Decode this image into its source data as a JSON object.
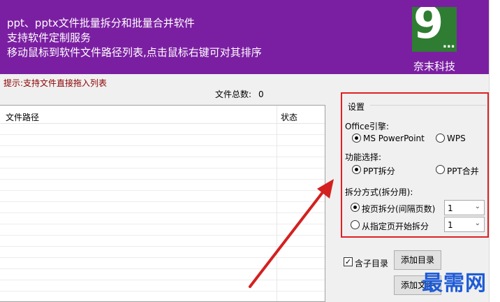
{
  "header": {
    "line1": "ppt、pptx文件批量拆分和批量合并软件",
    "line2": "支持软件定制服务",
    "line3": "移动鼠标到软件文件路径列表,点击鼠标右键可对其排序",
    "brand": "奈末科技",
    "logo_digit": "9",
    "logo_dots": "...",
    "colors": {
      "header_bg": "#7b1fa2",
      "logo_bg": "#2e7d32",
      "highlight": "#e02020",
      "watermark": "#1e5bd6"
    }
  },
  "hint": "提示:支持文件直接拖入列表",
  "file_count": {
    "label": "文件总数:",
    "value": "0"
  },
  "list": {
    "col_path": "文件路径",
    "col_status": "状态",
    "rows": []
  },
  "settings": {
    "title": "设置",
    "engine_label": "Office引擎:",
    "engine_options": [
      "MS PowerPoint",
      "WPS"
    ],
    "engine_selected": "MS PowerPoint",
    "function_label": "功能选择:",
    "function_options": [
      "PPT拆分",
      "PPT合并"
    ],
    "function_selected": "PPT拆分",
    "split_label": "拆分方式(拆分用):",
    "split_option1": "按页拆分(间隔页数)",
    "split_option1_value": "1",
    "split_option2": "从指定页开始拆分",
    "split_option2_value": "1",
    "split_selected": "按页拆分(间隔页数)"
  },
  "actions": {
    "include_subdir": "含子目录",
    "include_subdir_checked": true,
    "add_dir": "添加目录",
    "add_file": "添加文件"
  },
  "watermark": "最需网"
}
